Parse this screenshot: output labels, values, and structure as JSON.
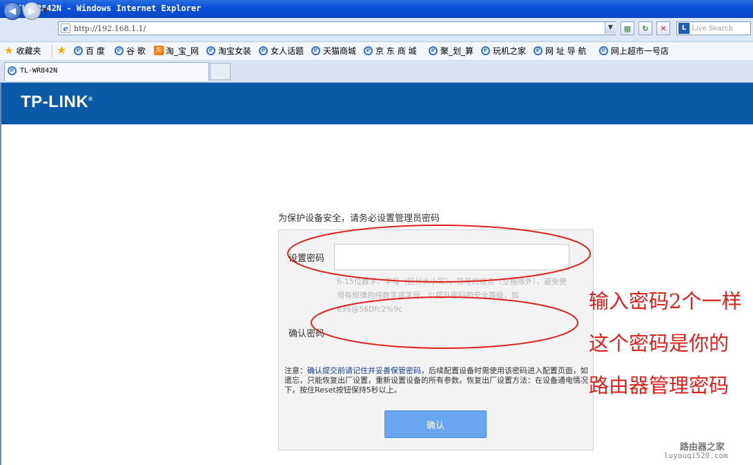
{
  "window": {
    "title": "TL-WR842N - Windows Internet Explorer"
  },
  "address_bar": {
    "url": "http://192.168.1.1/"
  },
  "search": {
    "placeholder": "Live Search",
    "icon_text": "L"
  },
  "favorites": {
    "label": "收藏夹",
    "items": [
      "百 度",
      "谷 歌",
      "淘_宝_网",
      "淘宝女装",
      "女人话题",
      "天猫商城",
      "京 东 商 城",
      "聚_划_算",
      "玩机之家",
      "网 址 导 航",
      "网上超市一号店"
    ]
  },
  "tabs": [
    {
      "label": "TL-WR842N"
    }
  ],
  "page": {
    "logo": "TP-LINK",
    "logo_mark": "®",
    "notice": "为保护设备安全，请务必设置管理员密码",
    "password_label": "设置密码",
    "password_hint": "6-15位数字、字母（区分大小写）、符号的组合（空格除外），避免使用有规律的纯数字或字母，以提升密码的安全等级，如83$@56Dfc2%9c",
    "confirm_label": "确认密码",
    "note_prefix": "注意：",
    "note_highlight": "确认提交前请记住并妥善保管密码",
    "note_rest": "，后续配置设备时需使用该密码进入配置页面，如遗忘，只能恢复出厂设置，重新设置设备的所有参数。恢复出厂设置方法：在设备通电情况下，按住Reset按钮保持5秒以上。",
    "submit_label": "确认"
  },
  "annotations": [
    "输入密码2个一样",
    "这个密码是你的",
    "路由器管理密码"
  ],
  "watermark": {
    "line1": "路由器之家",
    "line2": "luyouqi520.com"
  },
  "colors": {
    "banner": "#0b5aa8",
    "button": "#6aa6f0",
    "annotation": "#e0201c"
  }
}
